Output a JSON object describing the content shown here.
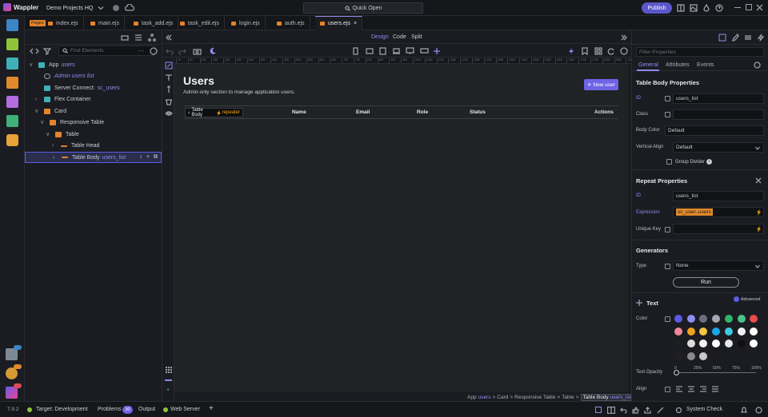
{
  "app": {
    "name": "Wappler",
    "project": "Demo Projects HQ",
    "quick_open": "Quick Open",
    "publish": "Publish"
  },
  "tabs": [
    {
      "label": "Pages",
      "badge": true
    },
    {
      "label": "index.ejs"
    },
    {
      "label": "main.ejs"
    },
    {
      "label": "task_add.ejs"
    },
    {
      "label": "task_edit.ejs"
    },
    {
      "label": "login.ejs"
    },
    {
      "label": "auth.ejs"
    },
    {
      "label": "users.ejs",
      "active": true
    }
  ],
  "structure": {
    "search_placeholder": "Find Elements",
    "items": [
      {
        "label": "App",
        "extra": "users",
        "indent": 0,
        "icon": "app"
      },
      {
        "label": "Admin users list",
        "indent": 1,
        "icon": "comment",
        "italic": true
      },
      {
        "label": "Server Connect:",
        "extra": "sc_users",
        "indent": 1,
        "icon": "server"
      },
      {
        "label": "Flex Container",
        "indent": 1,
        "icon": "flex"
      },
      {
        "label": "Card",
        "indent": 1,
        "icon": "card"
      },
      {
        "label": "Responsive Table",
        "indent": 2,
        "icon": "table"
      },
      {
        "label": "Table",
        "indent": 3,
        "icon": "table"
      },
      {
        "label": "Table Head",
        "indent": 4,
        "icon": "row"
      },
      {
        "label": "Table Body",
        "extra": "users_list",
        "indent": 4,
        "icon": "row",
        "selected": true
      }
    ]
  },
  "view": {
    "design": "Design",
    "code": "Code",
    "split": "Split"
  },
  "page": {
    "title": "Users",
    "subtitle": "Admin-only section to manage application users.",
    "new_user": "New user",
    "table_body_tag": "Table Body",
    "repeater": "repeater",
    "columns": [
      "Name",
      "Email",
      "Role",
      "Status",
      "Actions"
    ]
  },
  "ruler_ticks": [
    "10",
    "50",
    "100",
    "150",
    "200",
    "250",
    "300",
    "350",
    "400",
    "450",
    "500",
    "550",
    "600",
    "650",
    "700",
    "750",
    "800",
    "850",
    "900",
    "950",
    "1000",
    "1050",
    "1100",
    "1150",
    "1200",
    "1250",
    "1300",
    "1350",
    "1400",
    "1450",
    "1500",
    "1550",
    "1600",
    "1650",
    "1700",
    "1750",
    "1800",
    "1850",
    "1900"
  ],
  "breadcrumb": {
    "parts": [
      "App",
      "Card",
      "Responsive Table",
      "Table"
    ],
    "app_extra": "users",
    "selected": "Table Body",
    "selected_extra": "users_list"
  },
  "props": {
    "search_placeholder": "Filter Properties",
    "tabs": [
      "General",
      "Attributes",
      "Events"
    ],
    "table_body": {
      "heading": "Table Body Properties",
      "id_label": "ID",
      "id": "users_list",
      "class_label": "Class",
      "class": "",
      "body_color_label": "Body Color",
      "body_color": "Default",
      "valign_label": "Vertical Align",
      "valign": "Default",
      "group_divider": "Group Divider"
    },
    "repeat": {
      "heading": "Repeat Properties",
      "id_label": "ID",
      "id": "users_list",
      "expr_label": "Expression",
      "expr": "sc_user..users",
      "key_label": "Unique Key",
      "key": ""
    },
    "generators": {
      "heading": "Generators",
      "type_label": "Type",
      "type": "None",
      "run": "Run"
    },
    "text": {
      "heading": "Text",
      "advanced": "Advanced",
      "color_label": "Color",
      "opacity_label": "Text Opacity",
      "opacity_ticks": [
        "0",
        "25%",
        "50%",
        "75%",
        "100%"
      ],
      "align_label": "Align"
    },
    "swatches": [
      "#5a5ce8",
      "#8b8ff0",
      "#6b7080",
      "#a3a7b0",
      "#2fb56a",
      "#49c28a",
      "#e84c4c",
      "#ee8a9a",
      "#f0a21b",
      "#f5c542",
      "#1aa7e6",
      "#3ccbe0",
      "#f2f2f2",
      "#ffffff",
      "#1e1e1e",
      "#dcdcdc",
      "#f4f4f4",
      "#ffffff",
      "#e8e8e8",
      "#111111",
      "#ffffff",
      "#202020",
      "#8a8a8a",
      "#c8c8c8"
    ]
  },
  "status": {
    "version": "7.9.2",
    "target": "Target:",
    "target_value": "Development",
    "problems": "Problems",
    "problems_count": "30",
    "output": "Output",
    "web_server": "Web Server",
    "system_check": "System Check"
  }
}
